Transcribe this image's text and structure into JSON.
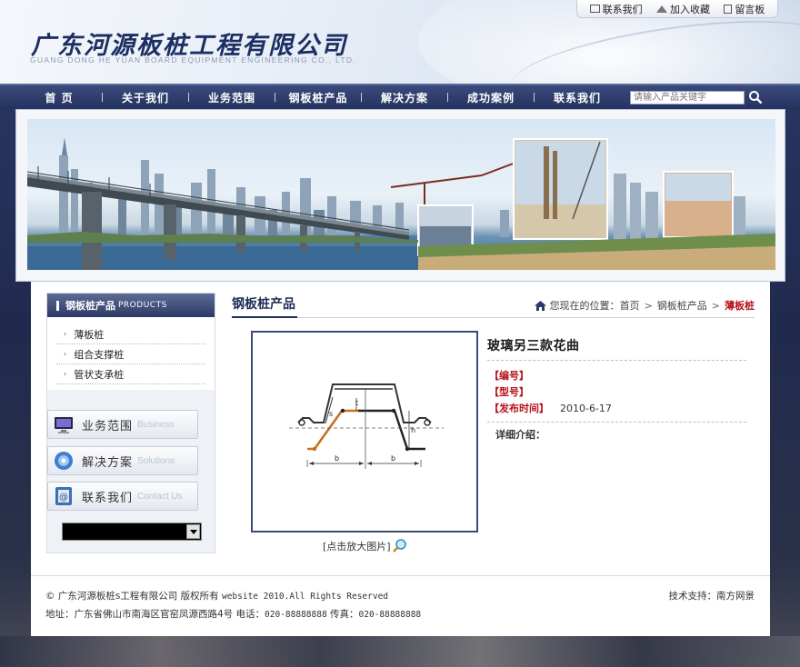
{
  "header": {
    "logo_cn": "广东河源板桩工程有限公司",
    "logo_en": "GUANG DONG HE YUAN BOARD EQUIPMENT ENGINEERING CO., LTD.",
    "toplinks": [
      {
        "label": "联系我们",
        "icon": "envelope-icon"
      },
      {
        "label": "加入收藏",
        "icon": "home-icon"
      },
      {
        "label": "留言板",
        "icon": "note-icon"
      }
    ]
  },
  "nav": {
    "items": [
      "首 页",
      "关于我们",
      "业务范围",
      "钢板桩产品",
      "解决方案",
      "成功案例",
      "联系我们"
    ],
    "search_placeholder": "请输入产品关键字"
  },
  "sidebar": {
    "title": "钢板桩产品",
    "title_en": "PRODUCTS",
    "items": [
      "薄板桩",
      "组合支撑桩",
      "管状支承桩"
    ],
    "buttons": [
      {
        "cn": "业务范围",
        "en": "Business",
        "icon": "monitor-icon"
      },
      {
        "cn": "解决方案",
        "en": "Solutions",
        "icon": "disc-icon"
      },
      {
        "cn": "联系我们",
        "en": "Contact Us",
        "icon": "contact-card-icon"
      }
    ]
  },
  "content": {
    "title": "钢板桩产品",
    "breadcrumb": {
      "prefix": "您现在的位置：",
      "items": [
        "首页",
        "钢板桩产品"
      ],
      "current": "薄板桩"
    },
    "product": {
      "name": "玻璃另三款花曲",
      "code_label": "【编号】",
      "type_label": "【型号】",
      "date_label": "【发布时间】",
      "date_value": "2010-6-17",
      "detail_label": "详细介绍："
    },
    "enlarge_label": "[点击放大图片]",
    "diagram_labels": {
      "t": "t",
      "s": "s",
      "h": "h",
      "b1": "b",
      "b2": "b"
    }
  },
  "footer": {
    "copyright_a": "© 广东河源板桩s工程有限公司 版权所有 ",
    "copyright_b": "website 2010.All Rights Reserved",
    "support": "技术支持：南方网景",
    "address_a": "地址：广东省佛山市南海区官窑凤源西路4号 电话：",
    "phone": "020-88888888",
    "fax_label": " 传真：",
    "fax": "020-88888888"
  },
  "colors": {
    "nav_bg": "#2c3a66",
    "accent_red": "#b5121b",
    "heading_navy": "#1e2d55"
  }
}
